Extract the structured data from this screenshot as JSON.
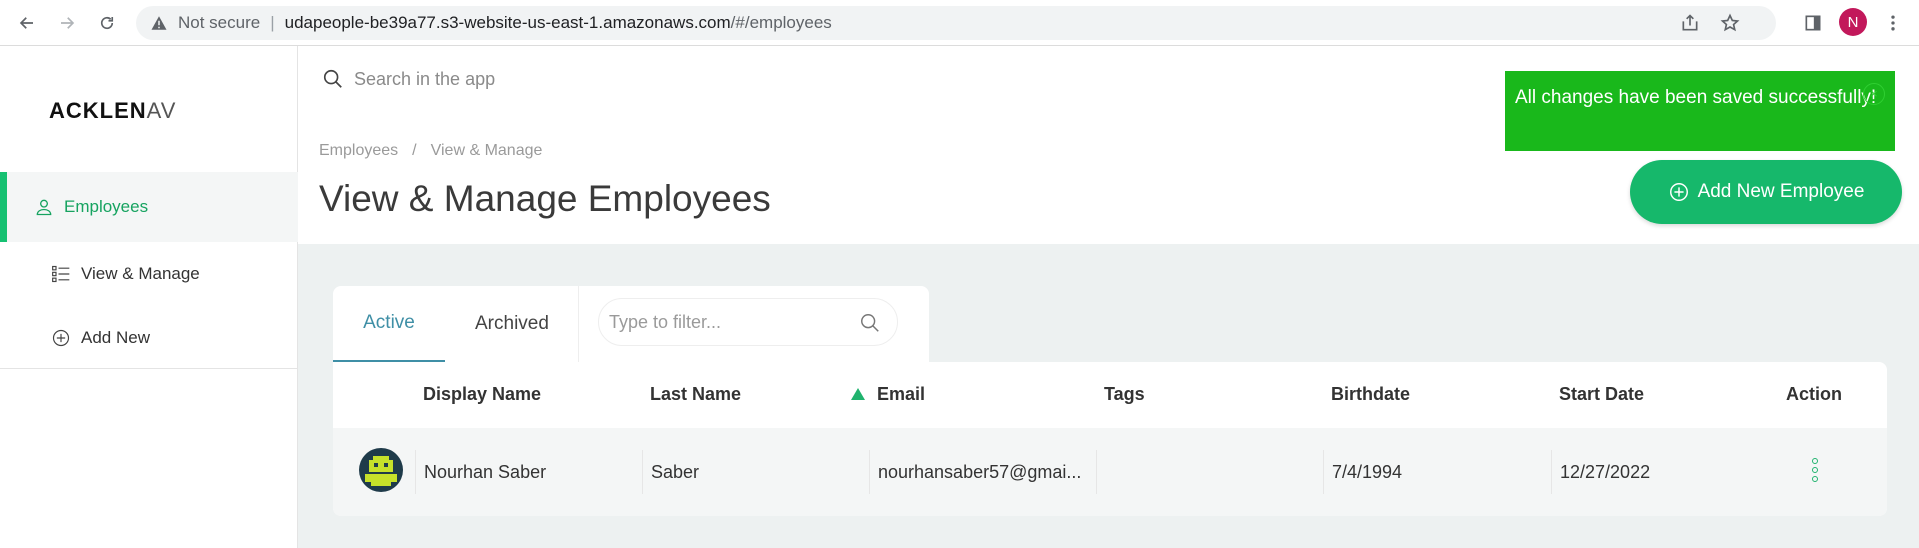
{
  "browser": {
    "not_secure": "Not secure",
    "url_host": "udapeople-be39a77.s3-website-us-east-1.amazonaws.com",
    "url_path": "/#/employees",
    "profile_initial": "N"
  },
  "sidebar": {
    "logo_main": "ACKLEN",
    "logo_tail": "AV",
    "items": [
      {
        "label": "Employees",
        "icon": "user-icon",
        "active": true
      },
      {
        "label": "View & Manage",
        "icon": "list-icon"
      },
      {
        "label": "Add New",
        "icon": "plus-circle-icon"
      }
    ]
  },
  "header": {
    "search_placeholder": "Search in the app",
    "breadcrumb": [
      "Employees",
      "View & Manage"
    ],
    "breadcrumb_sep": "/",
    "title": "View & Manage Employees",
    "add_button": "Add New Employee"
  },
  "toast": {
    "message": "All changes have been saved successfully!",
    "close": "×",
    "color": "#19b81b"
  },
  "tabs": {
    "active": "Active",
    "archived": "Archived",
    "filter_placeholder": "Type to filter..."
  },
  "table": {
    "columns": [
      "Display Name",
      "Last Name",
      "Email",
      "Tags",
      "Birthdate",
      "Start Date",
      "Action"
    ],
    "sorted_column": "Email",
    "rows": [
      {
        "display_name": "Nourhan Saber",
        "last_name": "Saber",
        "email": "nourhansaber57@gmai...",
        "tags": "",
        "birthdate": "7/4/1994",
        "start_date": "12/27/2022"
      }
    ]
  },
  "colors": {
    "accent": "#16b86b",
    "active_tab": "#3f8fa6"
  }
}
